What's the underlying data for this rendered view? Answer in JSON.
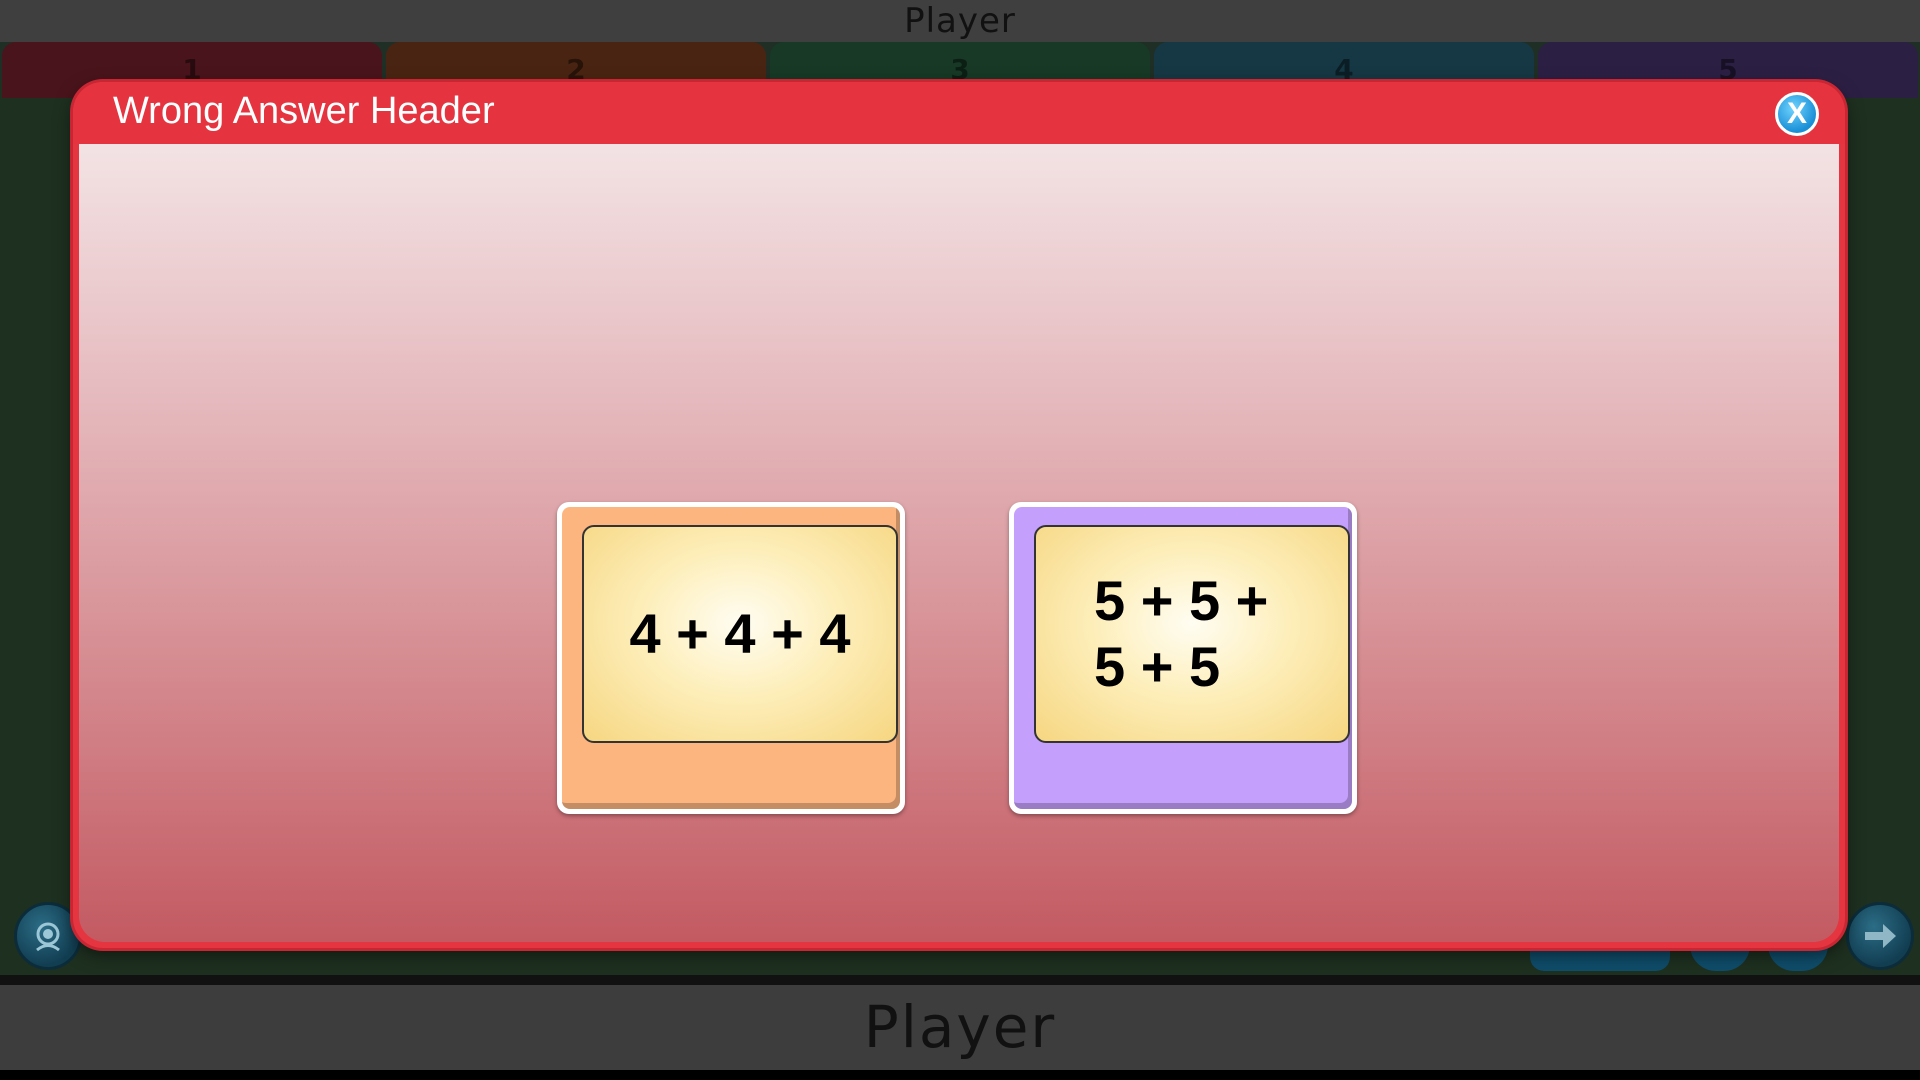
{
  "app": {
    "top_title": "Player",
    "bottom_title": "Player"
  },
  "tabs": [
    {
      "label": "1",
      "color": "#4a141c"
    },
    {
      "label": "2",
      "color": "#4a2412"
    },
    {
      "label": "3",
      "color": "#173926"
    },
    {
      "label": "4",
      "color": "#163844"
    },
    {
      "label": "5",
      "color": "#2c1f44"
    }
  ],
  "modal": {
    "title": "Wrong Answer Header",
    "close_label": "X",
    "cards": [
      {
        "text": "4 + 4 + 4",
        "color": "#fdb57f"
      },
      {
        "text": "5 + 5 + 5 + 5",
        "color": "#c49ffc"
      }
    ]
  },
  "icons": {
    "left_corner": "support-icon",
    "right_corner": "arrow-right-icon",
    "close": "close-icon"
  }
}
